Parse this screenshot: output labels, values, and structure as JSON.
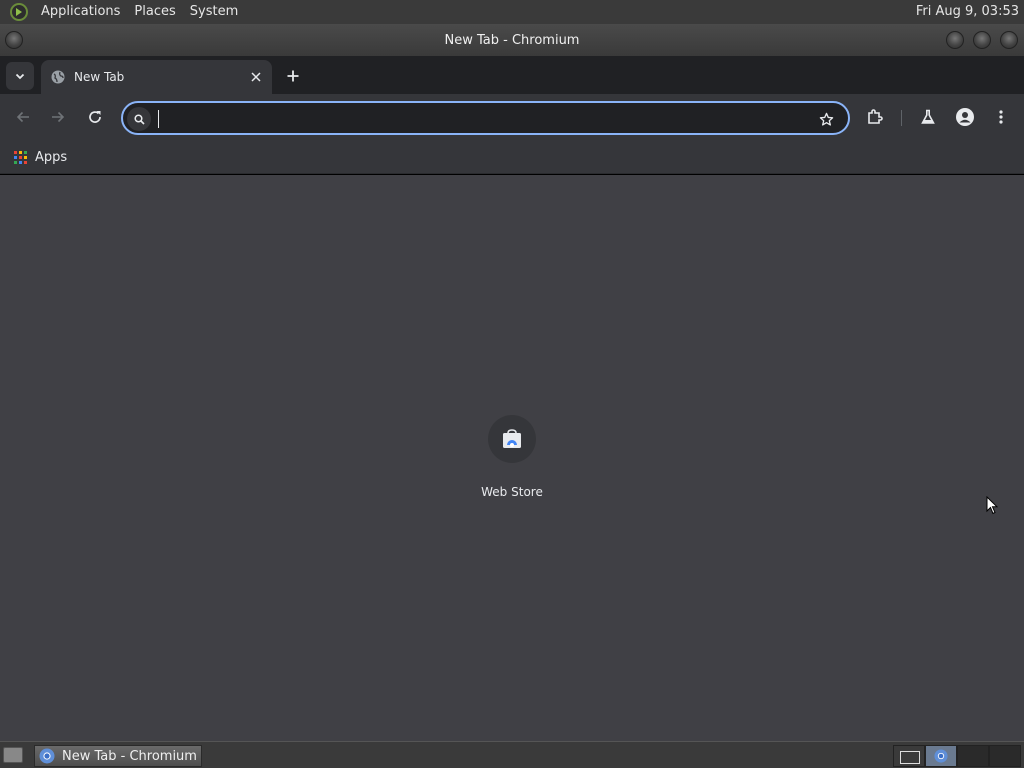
{
  "top_panel": {
    "menus": [
      "Applications",
      "Places",
      "System"
    ],
    "clock": "Fri Aug  9, 03:53"
  },
  "window": {
    "title": "New Tab - Chromium"
  },
  "tabs": [
    {
      "label": "New Tab",
      "active": true
    }
  ],
  "omnibox": {
    "value": "",
    "placeholder": ""
  },
  "bookmarks": {
    "apps_label": "Apps"
  },
  "shortcuts": [
    {
      "label": "Web Store",
      "icon": "web-store-icon"
    }
  ],
  "taskbar": {
    "window_button": "New Tab - Chromium"
  },
  "colors": {
    "focus_ring": "#8ab4f8",
    "content_bg": "#404045",
    "toolbar_bg": "#35363a",
    "tabstrip_bg": "#202124"
  }
}
